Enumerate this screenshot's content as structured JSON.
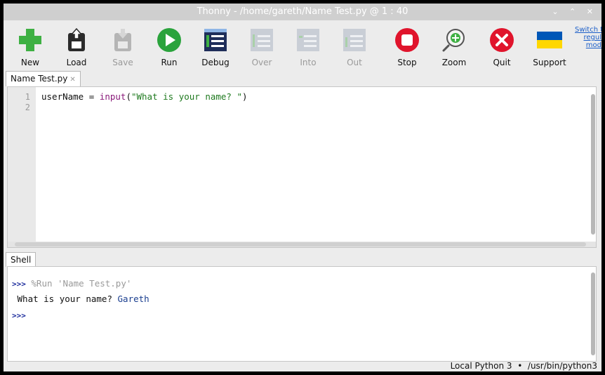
{
  "window": {
    "title": "Thonny  -  /home/gareth/Name Test.py  @  1 : 40",
    "controls": "⌄ ⌃ ✕"
  },
  "toolbar": {
    "buttons": [
      {
        "label": "New",
        "icon": "new-file-icon"
      },
      {
        "label": "Load",
        "icon": "load-icon"
      },
      {
        "label": "Save",
        "icon": "save-icon",
        "disabled": true
      },
      {
        "label": "Run",
        "icon": "run-icon"
      },
      {
        "label": "Debug",
        "icon": "debug-icon"
      },
      {
        "label": "Over",
        "icon": "step-over-icon",
        "disabled": true
      },
      {
        "label": "Into",
        "icon": "step-into-icon",
        "disabled": true
      },
      {
        "label": "Out",
        "icon": "step-out-icon",
        "disabled": true
      },
      {
        "label": "Stop",
        "icon": "stop-icon"
      },
      {
        "label": "Zoom",
        "icon": "zoom-icon"
      },
      {
        "label": "Quit",
        "icon": "quit-icon"
      },
      {
        "label": "Support",
        "icon": "ukraine-flag-icon"
      }
    ],
    "switch_mode": [
      "Switch t",
      "regul",
      "mod"
    ]
  },
  "editor": {
    "tab_label": "Name Test.py",
    "tab_close": "✕",
    "line_numbers": [
      "1",
      "2"
    ],
    "code": {
      "var": "userName = ",
      "fn": "input",
      "open": "(",
      "str": "\"What is your name? \"",
      "close": ")"
    }
  },
  "shell": {
    "tab_label": "Shell",
    "prompt": ">>>",
    "command": " %Run 'Name Test.py'",
    "output_text": " What is your name? ",
    "user_input": "Gareth"
  },
  "status": {
    "interpreter": "Local Python 3",
    "separator": "•",
    "path": "/usr/bin/python3"
  },
  "colors": {
    "run": "#2aa33c",
    "stop": "#e0142c",
    "new": "#3eb043",
    "debug": "#1f2e5a",
    "flag_blue": "#0057b7",
    "flag_yellow": "#ffd700"
  }
}
